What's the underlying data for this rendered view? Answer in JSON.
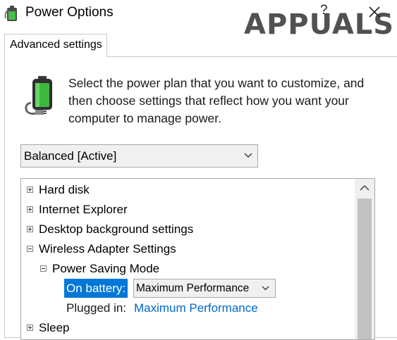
{
  "window": {
    "title": "Power Options",
    "help_label": "?",
    "app_icon": "power-options-icon",
    "close_icon": "close-icon"
  },
  "watermark": {
    "text": "APPUALS"
  },
  "tabs": [
    {
      "label": "Advanced settings",
      "active": true
    }
  ],
  "intro": {
    "text": "Select the power plan that you want to customize, and then choose settings that reflect how you want your computer to manage power.",
    "icon": "battery-plug-icon"
  },
  "plan_select": {
    "value": "Balanced [Active]"
  },
  "tree": {
    "items": [
      {
        "label": "Hard disk",
        "state": "collapsed"
      },
      {
        "label": "Internet Explorer",
        "state": "collapsed"
      },
      {
        "label": "Desktop background settings",
        "state": "collapsed"
      },
      {
        "label": "Wireless Adapter Settings",
        "state": "expanded"
      },
      {
        "label": "Power Saving Mode",
        "state": "expanded"
      },
      {
        "label": "Sleep",
        "state": "collapsed"
      }
    ],
    "on_battery": {
      "label": "On battery:",
      "value": "Maximum Performance"
    },
    "plugged_in": {
      "label": "Plugged in:",
      "value": "Maximum Performance"
    }
  },
  "colors": {
    "selection": "#0078d7",
    "link": "#0066cc",
    "battery_green": "#3cb83c"
  }
}
